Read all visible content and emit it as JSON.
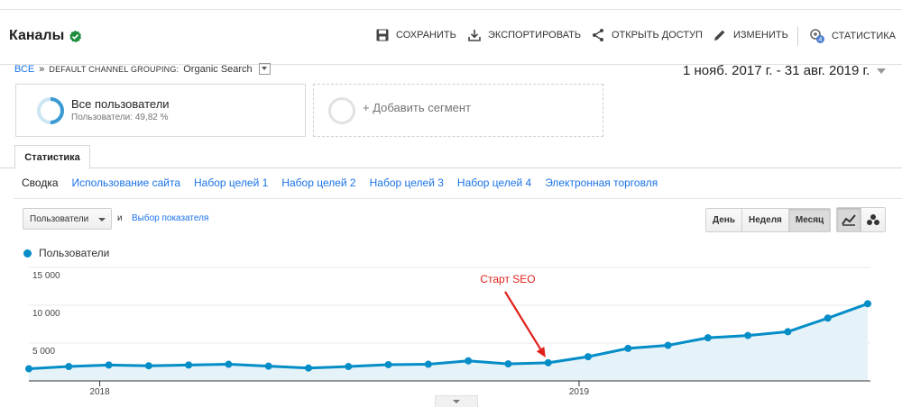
{
  "header": {
    "title": "Каналы",
    "save_label": "СОХРАНИТЬ",
    "export_label": "ЭКСПОРТИРОВАТЬ",
    "share_label": "ОТКРЫТЬ ДОСТУП",
    "edit_label": "ИЗМЕНИТЬ",
    "insights_label": "СТАТИСТИКА",
    "insights_badge": "4"
  },
  "breadcrumb": {
    "root": "ВСЕ",
    "separator": "»",
    "grouping": "DEFAULT CHANNEL GROUPING:",
    "value": "Organic Search"
  },
  "date_range": "1 нояб. 2017 г. - 31 авг. 2019 г.",
  "segments": {
    "active_name": "Все пользователи",
    "active_sub": "Пользователи: 49,82 %",
    "active_share": 0.4982,
    "add_label": "+ Добавить сегмент"
  },
  "tabs": {
    "active": "Статистика"
  },
  "subtabs": [
    "Сводка",
    "Использование сайта",
    "Набор целей 1",
    "Набор целей 2",
    "Набор целей 3",
    "Набор целей 4",
    "Электронная торговля"
  ],
  "controls": {
    "metric": "Пользователи",
    "and": "и",
    "pick_metric": "Выбор показателя",
    "periods": [
      "День",
      "Неделя",
      "Месяц"
    ],
    "active_period": "Месяц"
  },
  "chart_data": {
    "type": "area",
    "series": [
      {
        "name": "Пользователи",
        "values": [
          1600,
          1900,
          2100,
          2000,
          2100,
          2200,
          1950,
          1700,
          1900,
          2150,
          2200,
          2650,
          2250,
          2400,
          3200,
          4300,
          4700,
          5700,
          6000,
          6500,
          8300,
          10200
        ]
      }
    ],
    "x": [
      "2017-11",
      "2017-12",
      "2018-01",
      "2018-02",
      "2018-03",
      "2018-04",
      "2018-05",
      "2018-06",
      "2018-07",
      "2018-08",
      "2018-09",
      "2018-10",
      "2018-11",
      "2018-12",
      "2019-01",
      "2019-02",
      "2019-03",
      "2019-04",
      "2019-05",
      "2019-06",
      "2019-07",
      "2019-08"
    ],
    "x_tick_labels": [
      "2018",
      "2019"
    ],
    "y_ticks": [
      "15 000",
      "10 000",
      "5 000"
    ],
    "ylim": [
      0,
      15000
    ],
    "grid": true,
    "color": "#058dc7",
    "annotation": {
      "text": "Старт SEO",
      "at": "2018-12",
      "color": "#e0211b"
    }
  }
}
